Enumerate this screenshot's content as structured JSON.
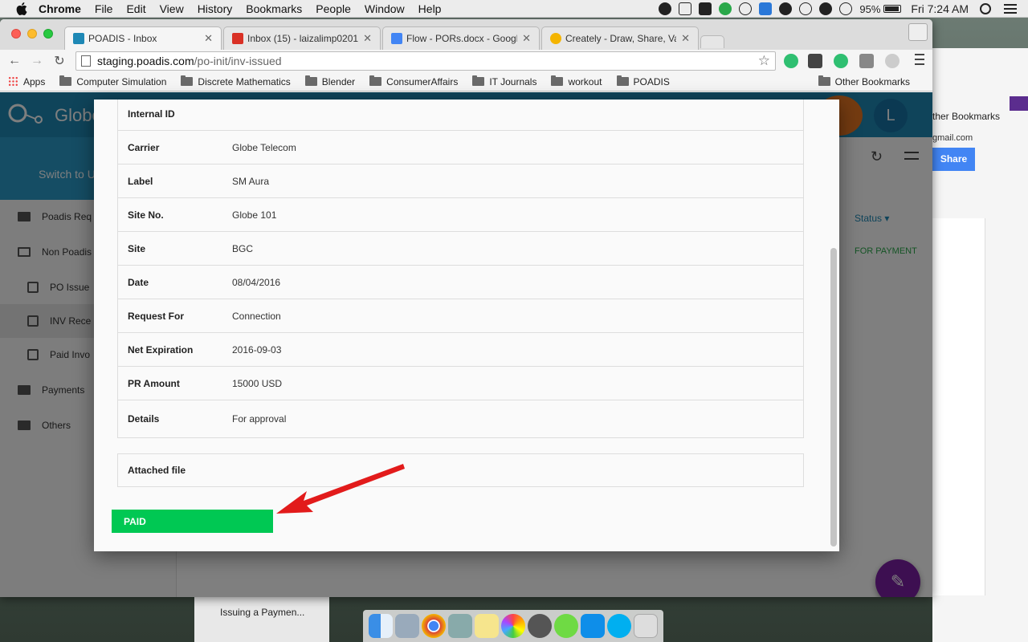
{
  "menubar": {
    "app": "Chrome",
    "items": [
      "File",
      "Edit",
      "View",
      "History",
      "Bookmarks",
      "People",
      "Window",
      "Help"
    ],
    "battery": "95%",
    "clock": "Fri 7:24 AM"
  },
  "tabs": [
    {
      "title": "POADIS - Inbox",
      "color": "#1e88b5"
    },
    {
      "title": "Inbox (15) - laizalimp0201",
      "color": "#d93025"
    },
    {
      "title": "Flow - PORs.docx - Google",
      "color": "#4285f4"
    },
    {
      "title": "Creately - Draw, Share, Vali",
      "color": "#f4b400"
    }
  ],
  "url": {
    "host": "staging.poadis.com",
    "path": "/po-init/inv-issued"
  },
  "bookmarks": {
    "apps": "Apps",
    "items": [
      "Computer Simulation",
      "Discrete Mathematics",
      "Blender",
      "ConsumerAffairs",
      "IT Journals",
      "workout",
      "POADIS"
    ],
    "other": "Other Bookmarks"
  },
  "app": {
    "title": "Globe",
    "avatar_letter": "L",
    "switch_label": "Switch to U",
    "sidebar": [
      {
        "label": "Poadis Req",
        "sub": false,
        "selected": false
      },
      {
        "label": "Non Poadis",
        "sub": false,
        "selected": false
      },
      {
        "label": "PO Issue",
        "sub": true,
        "selected": false
      },
      {
        "label": "INV Rece",
        "sub": true,
        "selected": true
      },
      {
        "label": "Paid Invo",
        "sub": true,
        "selected": false
      },
      {
        "label": "Payments",
        "sub": false,
        "selected": false
      },
      {
        "label": "Others",
        "sub": false,
        "selected": false
      }
    ],
    "status_header": "Status",
    "status_value": "FOR PAYMENT"
  },
  "modal": {
    "rows": [
      {
        "label": "Internal ID",
        "value": ""
      },
      {
        "label": "Carrier",
        "value": "Globe Telecom"
      },
      {
        "label": "Label",
        "value": "SM Aura"
      },
      {
        "label": "Site No.",
        "value": "Globe 101"
      },
      {
        "label": "Site",
        "value": "BGC"
      },
      {
        "label": "Date",
        "value": "08/04/2016"
      },
      {
        "label": "Request For",
        "value": "Connection"
      },
      {
        "label": "Net Expiration",
        "value": "2016-09-03"
      },
      {
        "label": "PR Amount",
        "value": "15000 USD"
      },
      {
        "label": "Details",
        "value": "For approval"
      }
    ],
    "attached_label": "Attached file",
    "paid_button": "PAID"
  },
  "docs_window": {
    "bookmarks_text": "ther Bookmarks",
    "email": "gmail.com",
    "share": "Share"
  },
  "taskwindow": {
    "title": "Issuing a Paymen..."
  },
  "colors": {
    "paid_green": "#00c853",
    "arrow_red": "#e21b1b",
    "header_blue": "#1e88b5",
    "fab_purple": "#7b1fa2"
  }
}
